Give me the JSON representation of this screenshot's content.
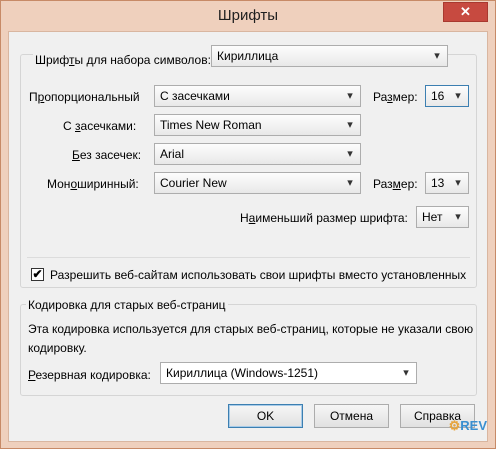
{
  "window": {
    "title": "Шрифты",
    "close_glyph": "✕"
  },
  "charset": {
    "label_prefix": "Шриф",
    "label_ul": "т",
    "label_suffix": "ы для набора символов:",
    "value": "Кириллица"
  },
  "proportional": {
    "label_prefix": "П",
    "label_ul": "р",
    "label_suffix": "опорциональный",
    "value": "С засечками",
    "size_label_prefix": "Ра",
    "size_label_ul": "з",
    "size_label_suffix": "мер:",
    "size_value": "16"
  },
  "serif": {
    "label_prefix": "С ",
    "label_ul": "з",
    "label_suffix": "асечками:",
    "value": "Times New Roman"
  },
  "sans": {
    "label_prefix": "",
    "label_ul": "Б",
    "label_suffix": "ез засечек:",
    "value": "Arial"
  },
  "mono": {
    "label_prefix": "Мон",
    "label_ul": "о",
    "label_suffix": "ширинный:",
    "value": "Courier New",
    "size_label_prefix": "Раз",
    "size_label_ul": "м",
    "size_label_suffix": "ер:",
    "size_value": "13"
  },
  "min_size": {
    "label_prefix": "Н",
    "label_ul": "а",
    "label_suffix": "именьший размер шрифта:",
    "value": "Нет"
  },
  "allow_fonts": {
    "checked": true,
    "check_glyph": "✔",
    "label": "Разрешить веб-сайтам использовать свои шрифты вместо установленных"
  },
  "encoding": {
    "legend": "Кодировка для старых веб-страниц",
    "desc_line1": "Эта кодировка используется для старых веб-страниц, которые не указали свою",
    "desc_line2": "кодировку.",
    "fallback_label_prefix": "",
    "fallback_label_ul": "Р",
    "fallback_label_suffix": "езервная кодировка:",
    "fallback_value": "Кириллица (Windows-1251)"
  },
  "buttons": {
    "ok": "OK",
    "cancel": "Отмена",
    "help": "Справка"
  },
  "watermark": {
    "text": "REV",
    "prefix_glyph": "⚙"
  },
  "icons": {
    "dropdown": "chevron-down-icon",
    "close": "close-icon",
    "checkmark": "checkmark-icon"
  }
}
